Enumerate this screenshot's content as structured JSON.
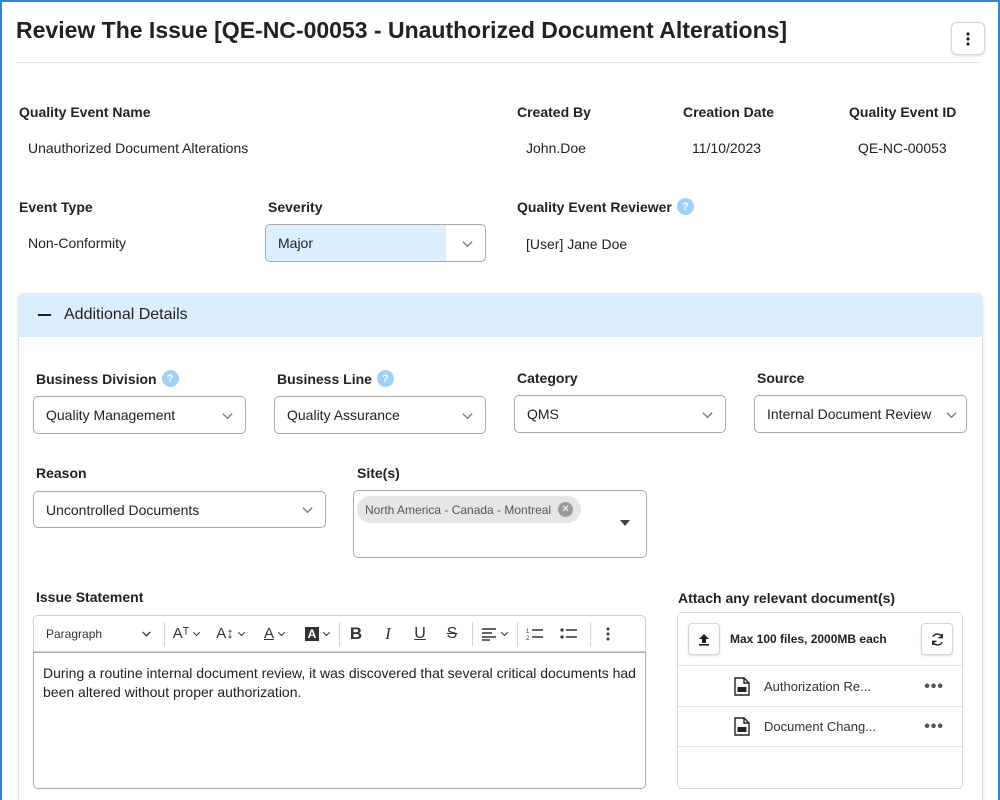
{
  "page": {
    "title": "Review The Issue [QE-NC-00053 - Unauthorized Document Alterations]",
    "menu_icon": "kebab-vertical-icon"
  },
  "summary": {
    "quality_event_name_label": "Quality Event Name",
    "quality_event_name": "Unauthorized Document Alterations",
    "created_by_label": "Created By",
    "created_by": "John.Doe",
    "creation_date_label": "Creation Date",
    "creation_date": "11/10/2023",
    "quality_event_id_label": "Quality Event ID",
    "quality_event_id": "QE-NC-00053",
    "event_type_label": "Event Type",
    "event_type": "Non-Conformity",
    "severity_label": "Severity",
    "severity_value": "Major",
    "reviewer_label": "Quality Event Reviewer",
    "reviewer": "[User] Jane Doe",
    "help_glyph": "?"
  },
  "additional_details": {
    "title": "Additional Details",
    "business_division_label": "Business Division",
    "business_division": "Quality Management",
    "business_line_label": "Business Line",
    "business_line": "Quality Assurance",
    "category_label": "Category",
    "category": "QMS",
    "source_label": "Source",
    "source": "Internal Document Review",
    "reason_label": "Reason",
    "reason": "Uncontrolled Documents",
    "sites_label": "Site(s)",
    "sites": [
      "North America - Canada - Montreal"
    ]
  },
  "issue_statement": {
    "label": "Issue Statement",
    "toolbar": {
      "paragraph_label": "Paragraph",
      "font_family_glyph": "Aᵀ",
      "font_size_glyph": "A↕",
      "font_color_glyph": "A",
      "highlight_glyph": "A",
      "bold": "B",
      "italic": "I",
      "underline": "U",
      "strikethrough": "S"
    },
    "text": "During a routine internal document review, it was discovered that several critical documents had been altered without proper authorization."
  },
  "attachments": {
    "label": "Attach any relevant document(s)",
    "limit_text": "Max 100 files, 2000MB each",
    "files": [
      {
        "name": "Authorization Re..."
      },
      {
        "name": "Document Chang..."
      }
    ],
    "more_glyph": "•••"
  },
  "colors": {
    "frame_border": "#2f86d6",
    "panel_header": "#dbeeff",
    "help_badge": "#9fd0f5",
    "severity_highlight": "#dcefff"
  }
}
